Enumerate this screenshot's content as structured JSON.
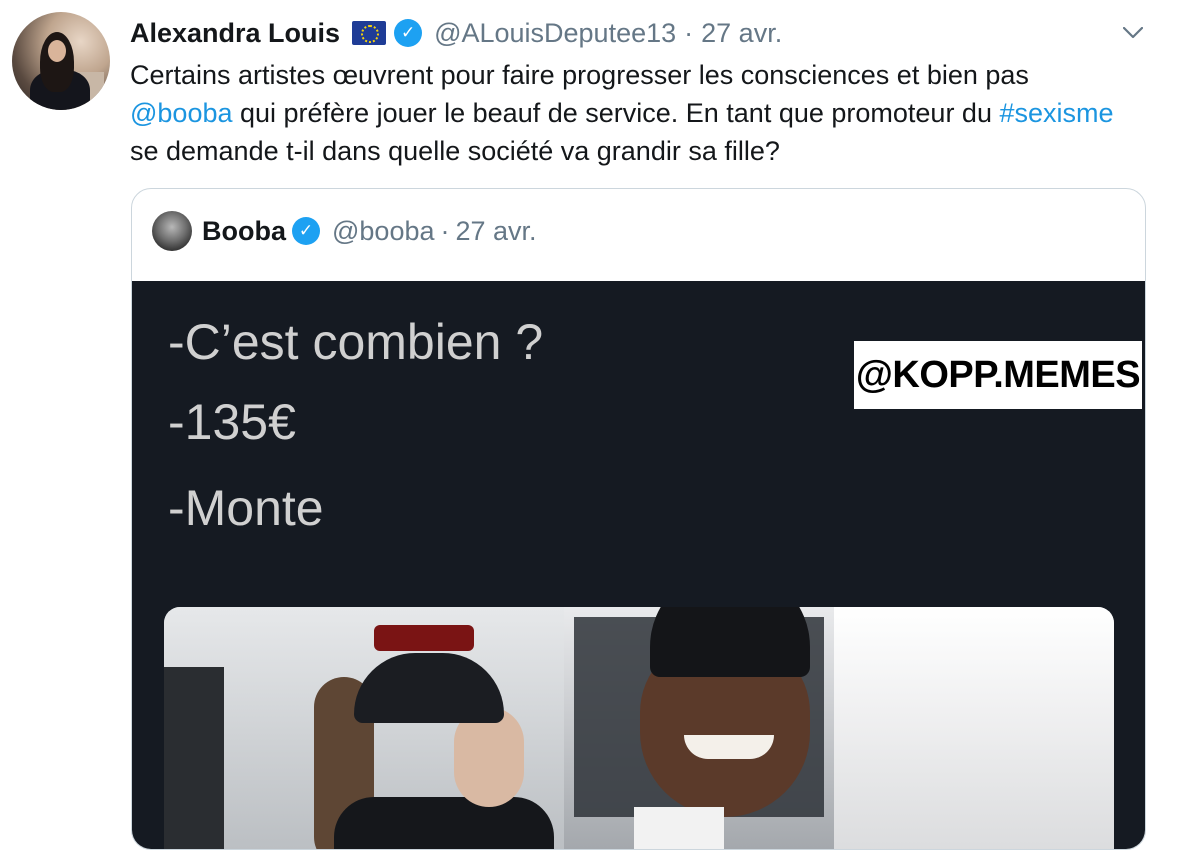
{
  "tweet": {
    "author_name": "Alexandra Louis",
    "author_handle": "@ALouisDeputee13",
    "separator": "·",
    "date": "27 avr.",
    "text": {
      "part1": "Certains artistes œuvrent pour faire progresser les consciences et bien pas ",
      "mention": "@booba",
      "part2": " qui préfère jouer le beauf de service. En tant que promoteur du ",
      "hashtag": "#sexisme",
      "part3": " se demande t-il dans quelle société va grandir sa fille?"
    },
    "icons": {
      "flag": "eu-flag-icon",
      "verified": "verified-badge-icon",
      "menu": "chevron-down-icon"
    }
  },
  "quoted": {
    "author_name": "Booba",
    "author_handle": "@booba",
    "separator": "·",
    "date": "27 avr.",
    "meme": {
      "line1": "-C’est combien ?",
      "line2": "-135€",
      "line3": "-Monte",
      "watermark": "@KOPP.MEMES"
    }
  },
  "colors": {
    "link": "#1b95e0",
    "verified": "#1da1f2",
    "secondary_text": "#657786",
    "border": "#ccd6dd",
    "meme_bg": "#151a22"
  }
}
